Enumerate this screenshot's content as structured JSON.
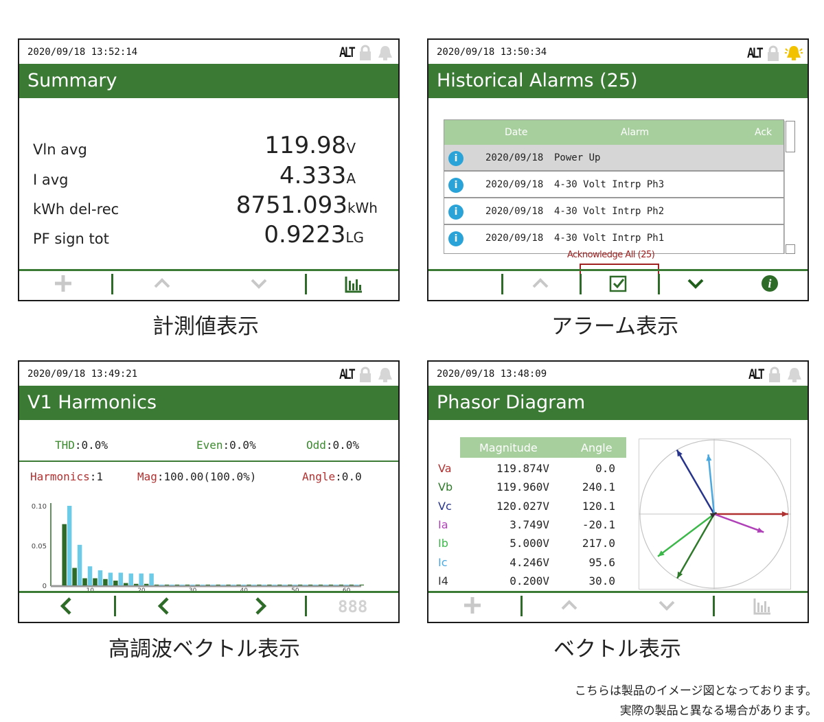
{
  "panels": {
    "summary": {
      "timestamp": "2020/09/18 13:52:14",
      "alt": "ALT",
      "title": "Summary",
      "rows": [
        {
          "label": "Vln avg",
          "value": "119.98",
          "unit": "V"
        },
        {
          "label": "I avg",
          "value": "4.333",
          "unit": "A"
        },
        {
          "label": "kWh del-rec",
          "value": "8751.093",
          "unit": "kWh"
        },
        {
          "label": "PF sign tot",
          "value": "0.9223",
          "unit": "LG"
        }
      ],
      "caption": "計測値表示"
    },
    "alarms": {
      "timestamp": "2020/09/18 13:50:34",
      "alt": "ALT",
      "title": "Historical Alarms (25)",
      "headers": {
        "date": "Date",
        "alarm": "Alarm",
        "ack": "Ack"
      },
      "rows": [
        {
          "date": "2020/09/18",
          "alarm": "Power Up",
          "icon": "i"
        },
        {
          "date": "2020/09/18",
          "alarm": "4-30 Volt Intrp Ph3",
          "icon": "i"
        },
        {
          "date": "2020/09/18",
          "alarm": "4-30 Volt Intrp Ph2",
          "icon": "i"
        },
        {
          "date": "2020/09/18",
          "alarm": "4-30 Volt Intrp Ph1",
          "icon": "i"
        }
      ],
      "ack_all": "Acknowledge All (25)",
      "caption": "アラーム表示"
    },
    "harmonics": {
      "timestamp": "2020/09/18 13:49:21",
      "alt": "ALT",
      "title": "V1 Harmonics",
      "thd_label": "THD",
      "thd_value": ":0.0%",
      "even_label": "Even",
      "even_value": ":0.0%",
      "odd_label": "Odd",
      "odd_value": ":0.0%",
      "harm_label": "Harmonics",
      "harm_value": ":1",
      "mag_label": "Mag",
      "mag_value": ":100.00(100.0%)",
      "angle_label": "Angle",
      "angle_value": ":0.0",
      "toolbar_counter": "888",
      "caption": "高調波ベクトル表示"
    },
    "phasor": {
      "timestamp": "2020/09/18 13:48:09",
      "alt": "ALT",
      "title": "Phasor Diagram",
      "headers": {
        "magnitude": "Magnitude",
        "angle": "Angle"
      },
      "rows": [
        {
          "name": "Va",
          "magnitude": "119.874V",
          "angle": "0.0",
          "color": "#b03030"
        },
        {
          "name": "Vb",
          "magnitude": "119.960V",
          "angle": "240.1",
          "color": "#2e7a2a"
        },
        {
          "name": "Vc",
          "magnitude": "120.027V",
          "angle": "120.1",
          "color": "#27348b"
        },
        {
          "name": "Ia",
          "magnitude": "3.749V",
          "angle": "-20.1",
          "color": "#b040b8"
        },
        {
          "name": "Ib",
          "magnitude": "5.000V",
          "angle": "217.0",
          "color": "#3cb84a"
        },
        {
          "name": "Ic",
          "magnitude": "4.246V",
          "angle": "95.6",
          "color": "#4aa8e0"
        },
        {
          "name": "I4",
          "magnitude": "0.200V",
          "angle": "30.0",
          "color": "#333333"
        }
      ],
      "caption": "ベクトル表示"
    }
  },
  "chart_data": {
    "type": "bar",
    "xlim": [
      1,
      63
    ],
    "xticks": [
      10,
      20,
      30,
      40,
      50,
      60
    ],
    "ylim": [
      0,
      0.1
    ],
    "yticks": [
      "0.10",
      "0.05",
      "0"
    ],
    "series": [
      {
        "color": "#2e6b28",
        "x": [
          5,
          7,
          9,
          11,
          13,
          15,
          17,
          19,
          21,
          23,
          25,
          27,
          29,
          31,
          33,
          35,
          37,
          39,
          41,
          43,
          45,
          47,
          49,
          51,
          53,
          55,
          57,
          59,
          61,
          63
        ],
        "values": [
          0.077,
          0.022,
          0.009,
          0.009,
          0.008,
          0.006,
          0.003,
          0.002,
          0.002,
          0.001,
          0.001,
          0.001,
          0.001,
          0.001,
          0.001,
          0.001,
          0.001,
          0.001,
          0.001,
          0.001,
          0.001,
          0.001,
          0.001,
          0.001,
          0.001,
          0.001,
          0.001,
          0.001,
          0.001,
          0.001
        ]
      },
      {
        "color": "#6ecbe8",
        "x": [
          6,
          8,
          10,
          12,
          14,
          16,
          18,
          20,
          22,
          24,
          26,
          28,
          30,
          32,
          34,
          36,
          38,
          40,
          42,
          44,
          46,
          48,
          50,
          52,
          54,
          56,
          58,
          60,
          62
        ],
        "values": [
          0.1,
          0.051,
          0.024,
          0.019,
          0.016,
          0.016,
          0.015,
          0.015,
          0.015,
          0.001,
          0.001,
          0.001,
          0.001,
          0.001,
          0.001,
          0.001,
          0.001,
          0.001,
          0.001,
          0.001,
          0.001,
          0.001,
          0.001,
          0.001,
          0.001,
          0.001,
          0.001,
          0.001,
          0.001
        ]
      }
    ]
  },
  "footer": {
    "note1": "こちらは製品のイメージ図となっております。",
    "note2": "実際の製品と異なる場合があります。"
  }
}
